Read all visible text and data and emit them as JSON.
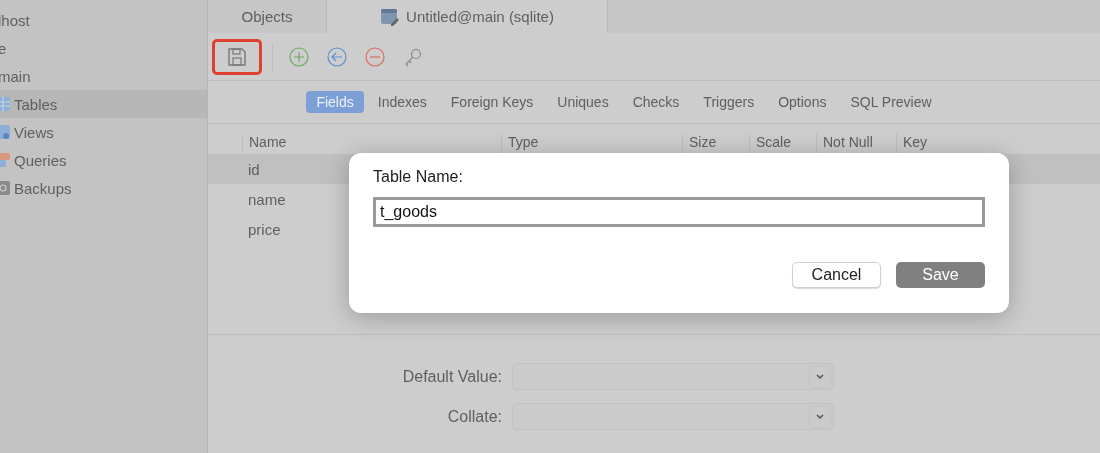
{
  "sidebar": {
    "items": [
      {
        "label": "lhost",
        "kind": "connection",
        "selected": false
      },
      {
        "label": "e",
        "kind": "database",
        "selected": false
      },
      {
        "label": "main",
        "kind": "schema",
        "selected": false
      },
      {
        "label": "Tables",
        "kind": "table",
        "selected": true
      },
      {
        "label": "Views",
        "kind": "view",
        "selected": false
      },
      {
        "label": "Queries",
        "kind": "query",
        "selected": false
      },
      {
        "label": "Backups",
        "kind": "backup",
        "selected": false
      }
    ]
  },
  "tabs": [
    {
      "label": "Objects",
      "selected": false
    },
    {
      "label": "Untitled@main (sqlite)",
      "selected": true
    }
  ],
  "toolbar": {
    "save_highlighted": true
  },
  "subtabs": [
    {
      "label": "Fields",
      "selected": true
    },
    {
      "label": "Indexes",
      "selected": false
    },
    {
      "label": "Foreign Keys",
      "selected": false
    },
    {
      "label": "Uniques",
      "selected": false
    },
    {
      "label": "Checks",
      "selected": false
    },
    {
      "label": "Triggers",
      "selected": false
    },
    {
      "label": "Options",
      "selected": false
    },
    {
      "label": "SQL Preview",
      "selected": false
    }
  ],
  "table": {
    "columns": [
      "Name",
      "Type",
      "Size",
      "Scale",
      "Not Null",
      "Key"
    ],
    "rows": [
      {
        "name": "id",
        "selected": true
      },
      {
        "name": "name",
        "selected": false
      },
      {
        "name": "price",
        "selected": false
      }
    ]
  },
  "properties": [
    {
      "label": "Default Value:"
    },
    {
      "label": "Collate:"
    }
  ],
  "dialog": {
    "label": "Table Name:",
    "value": "t_goods",
    "buttons": [
      {
        "label": "Cancel",
        "kind": "secondary"
      },
      {
        "label": "Save",
        "kind": "primary"
      }
    ]
  }
}
